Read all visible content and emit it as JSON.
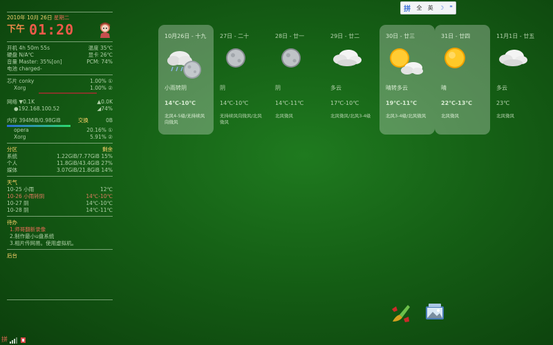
{
  "conky": {
    "date": "2010年 10月 26日",
    "weekday": "星期二",
    "ampm": "下午",
    "time": "01:20",
    "sys": [
      {
        "label": "开机 4h 50m 55s",
        "right": "温度 35℃"
      },
      {
        "label": "硬盘 N/A℃",
        "right": "显卡 26℃"
      },
      {
        "label": "音量 Master: 35%[on]",
        "right": "PCM: 74%"
      },
      {
        "label": "电池 charged-",
        "right": ""
      }
    ],
    "cpu": {
      "head": "芯片 conky",
      "head_val": "1.00% ①",
      "sub": "Xorg",
      "sub_val": "1.00% ②"
    },
    "net": {
      "down_label": "网络 ▼0.1K",
      "up": "▲0.0K",
      "ip": "●192.168.100.52",
      "wifi": "◢74%"
    },
    "mem": {
      "head": "内存 394MiB/0.98GiB",
      "swap_label": "交换",
      "swap": "0B",
      "p1": "opera",
      "p1_val": "20.16% ①",
      "p2": "Xorg",
      "p2_val": "5.91% ②"
    },
    "part": {
      "title": "分区",
      "col": "剩余",
      "rows": [
        {
          "name": "系统",
          "val": "1.22GiB/7.77GiB 15%"
        },
        {
          "name": "个人",
          "val": "11.8GiB/43.4GiB 27%"
        },
        {
          "name": "媒体",
          "val": "3.07GiB/21.8GiB 14%"
        }
      ]
    },
    "wx": {
      "title": "天气",
      "rows": [
        {
          "d": "10-25  小雨",
          "t": "12℃"
        },
        {
          "d": "10-26  小雨转阴",
          "t": "14℃-10℃"
        },
        {
          "d": "10-27  阴",
          "t": "14℃-10℃"
        },
        {
          "d": "10-28  阴",
          "t": "14℃-11℃"
        }
      ]
    },
    "todo": {
      "title": "待办",
      "items": [
        "1.师哥翻新录像",
        "2.制作最小u盘系统",
        "3.相片传网易。使用虚拟机。"
      ]
    },
    "bg": {
      "title": "后台"
    }
  },
  "weather": [
    {
      "date": "10月26日 - 十九",
      "cond": "小雨转阴",
      "temp": "14℃-10℃",
      "wind": "北风4-5级/无持续风向微风",
      "icon": "rain-to-cloudy-icon",
      "hl": true
    },
    {
      "date": "27日 - 二十",
      "cond": "阴",
      "temp": "14℃-10℃",
      "wind": "无持续风向微风/北风微风",
      "icon": "overcast-icon",
      "hl": false
    },
    {
      "date": "28日 - 廿一",
      "cond": "阴",
      "temp": "14℃-11℃",
      "wind": "北风微风",
      "icon": "overcast-icon",
      "hl": false
    },
    {
      "date": "29日 - 廿二",
      "cond": "多云",
      "temp": "17℃-10℃",
      "wind": "北风微风/北风3-4级",
      "icon": "cloudy-icon",
      "hl": false
    },
    {
      "date": "30日 - 廿三",
      "cond": "晴转多云",
      "temp": "19℃-11℃",
      "wind": "北风3-4级/北风微风",
      "icon": "sunny-to-cloudy-icon",
      "hl": true
    },
    {
      "date": "31日 - 廿四",
      "cond": "晴",
      "temp": "22℃-13℃",
      "wind": "北风微风",
      "icon": "sunny-icon",
      "hl": true
    },
    {
      "date": "11月1日 - 廿五",
      "cond": "多云",
      "temp": "23℃",
      "wind": "北风微风",
      "icon": "cloudy-icon",
      "hl": false
    }
  ],
  "ime": {
    "full": "全",
    "lang": "英",
    "moon": "☽",
    "punct": "❞"
  },
  "colors": {
    "desktop": "#155f15",
    "accent": "#f05a4a",
    "warn": "#e07a5f"
  }
}
